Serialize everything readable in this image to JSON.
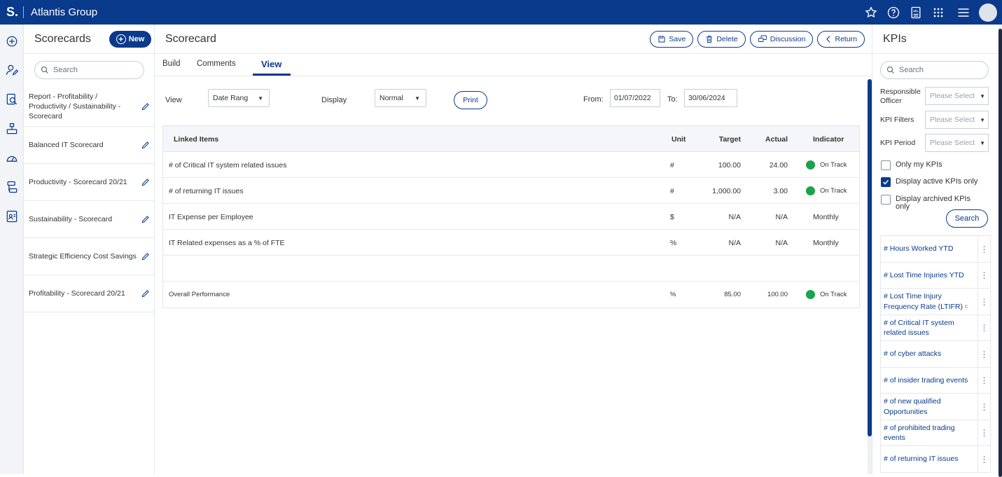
{
  "topbar": {
    "logo": "S.",
    "org": "Atlantis Group"
  },
  "icons": {
    "star": "star-icon",
    "help": "help-icon",
    "report": "report-icon",
    "apps": "apps-grid-icon",
    "menu": "menu-icon",
    "user": "user-avatar"
  },
  "list_panel": {
    "title": "Scorecards",
    "new_label": "New",
    "search_placeholder": "Search",
    "items": [
      {
        "label": "Report - Profitability / Productivity / Sustainability - Scorecard"
      },
      {
        "label": "Balanced IT Scorecard"
      },
      {
        "label": "Productivity - Scorecard 20/21"
      },
      {
        "label": "Sustainability - Scorecard"
      },
      {
        "label": "Strategic Efficiency Cost Savings"
      },
      {
        "label": "Profitability - Scorecard 20/21"
      }
    ]
  },
  "main": {
    "title": "Scorecard",
    "buttons": {
      "save": "Save",
      "delete": "Delete",
      "discussion": "Discussion",
      "return": "Return"
    },
    "tabs": {
      "build": "Build",
      "comments": "Comments",
      "view": "View"
    },
    "controls": {
      "view_label": "View",
      "view_value": "Date Rang",
      "display_label": "Display",
      "display_value": "Normal",
      "print": "Print",
      "from_label": "From:",
      "from_value": "01/07/2022",
      "to_label": "To:",
      "to_value": "30/06/2024"
    },
    "table": {
      "headers": {
        "name": "Linked Items",
        "unit": "Unit",
        "target": "Target",
        "actual": "Actual",
        "indicator": "Indicator"
      },
      "rows": [
        {
          "name": "# of Critical IT system related issues",
          "unit": "#",
          "target": "100.00",
          "actual": "24.00",
          "indicator": "On Track",
          "status_color": "#1aa34a"
        },
        {
          "name": "# of returning IT issues",
          "unit": "#",
          "target": "1,000.00",
          "actual": "3.00",
          "indicator": "On Track",
          "status_color": "#1aa34a"
        },
        {
          "name": "IT Expense per Employee",
          "unit": "$",
          "target": "N/A",
          "actual": "N/A",
          "indicator": "Monthly"
        },
        {
          "name": "IT Related expenses as a % of FTE",
          "unit": "%",
          "target": "N/A",
          "actual": "N/A",
          "indicator": "Monthly"
        }
      ],
      "overall": {
        "name": "Overall Performance",
        "unit": "%",
        "target": "85.00",
        "actual": "100.00",
        "indicator": "On Track",
        "status_color": "#1aa34a"
      }
    }
  },
  "kpi_panel": {
    "title": "KPIs",
    "search_placeholder": "Search",
    "responsible_officer_label": "Responsible Officer",
    "kpi_filters_label": "KPI Filters",
    "kpi_period_label": "KPI Period",
    "select_placeholder": "Please Select",
    "only_my_kpis": "Only my KPIs",
    "only_my_kpis_checked": false,
    "active_only": "Display active KPIs only",
    "active_only_checked": true,
    "archived_only": "Display archived KPIs only",
    "archived_only_checked": false,
    "search_button": "Search",
    "items": [
      {
        "label": "# Hours Worked YTD"
      },
      {
        "label": "# Lost Time Injuries YTD"
      },
      {
        "label": "# Lost Time Injury Frequency Rate (LTIFR)",
        "flag": "c"
      },
      {
        "label": "# of Critical IT system related issues"
      },
      {
        "label": "# of cyber attacks"
      },
      {
        "label": "# of insider trading events"
      },
      {
        "label": "# of new qualified Opportunities"
      },
      {
        "label": "# of prohibited trading events"
      },
      {
        "label": "# of returning IT issues"
      }
    ]
  },
  "colors": {
    "brand": "#0a3a8c",
    "on_track": "#1aa34a"
  }
}
